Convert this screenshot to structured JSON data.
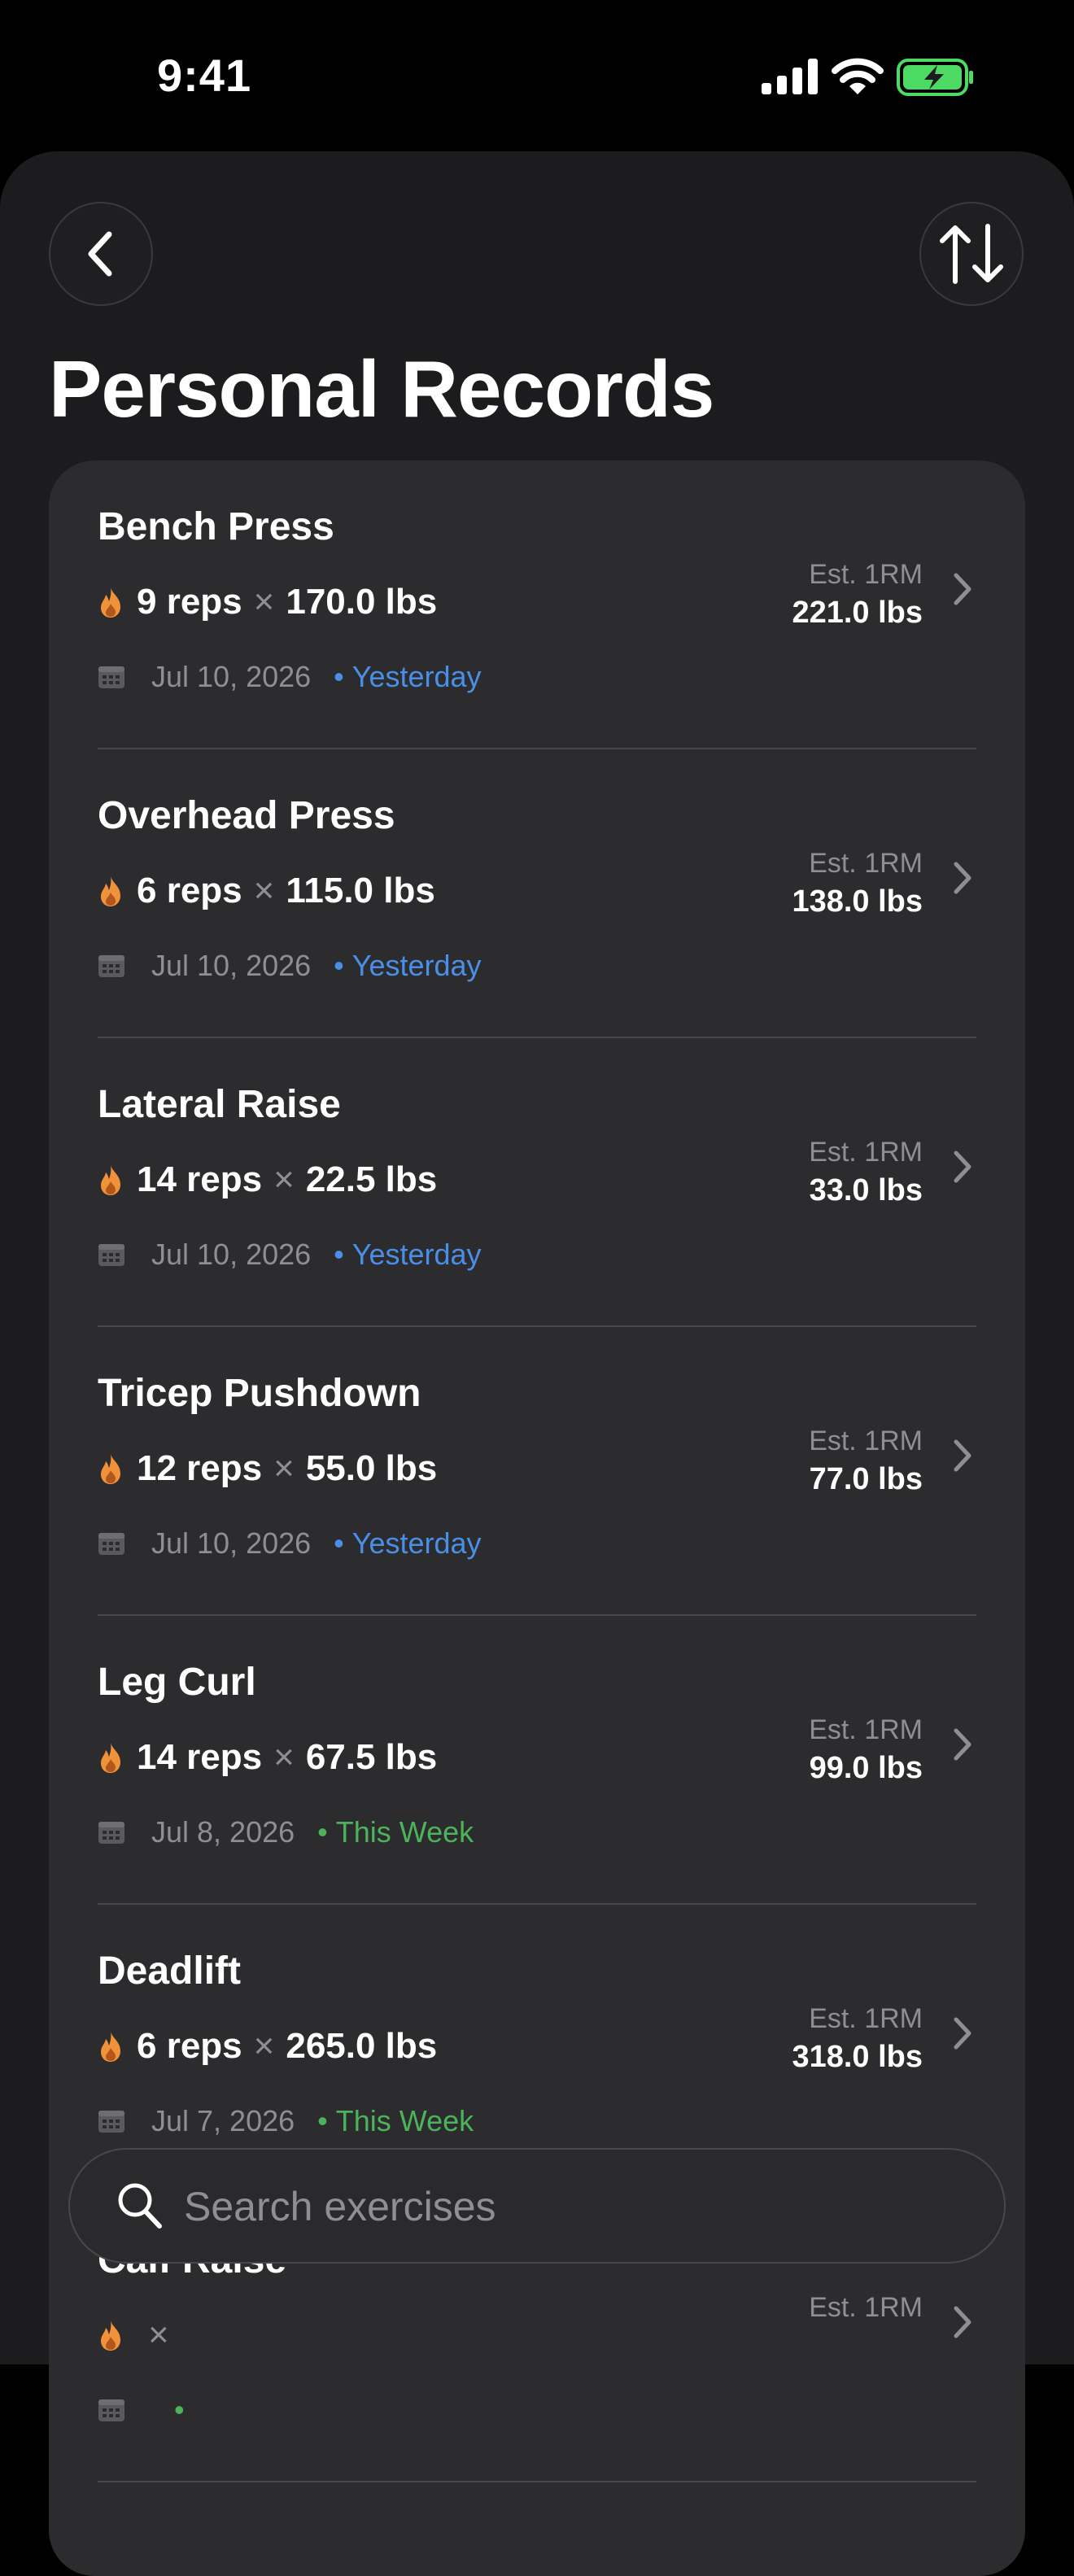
{
  "status_bar": {
    "time": "9:41"
  },
  "header": {
    "title": "Personal Records"
  },
  "records": [
    {
      "exercise": "Bench Press",
      "reps": "9 reps",
      "weight": "170.0 lbs",
      "est_label": "Est. 1RM",
      "est_value": "221.0 lbs",
      "date": "Jul 10, 2026",
      "relative": "Yesterday",
      "relative_color": "#4a8fe7"
    },
    {
      "exercise": "Overhead Press",
      "reps": "6 reps",
      "weight": "115.0 lbs",
      "est_label": "Est. 1RM",
      "est_value": "138.0 lbs",
      "date": "Jul 10, 2026",
      "relative": "Yesterday",
      "relative_color": "#4a8fe7"
    },
    {
      "exercise": "Lateral Raise",
      "reps": "14 reps",
      "weight": "22.5 lbs",
      "est_label": "Est. 1RM",
      "est_value": "33.0 lbs",
      "date": "Jul 10, 2026",
      "relative": "Yesterday",
      "relative_color": "#4a8fe7"
    },
    {
      "exercise": "Tricep Pushdown",
      "reps": "12 reps",
      "weight": "55.0 lbs",
      "est_label": "Est. 1RM",
      "est_value": "77.0 lbs",
      "date": "Jul 10, 2026",
      "relative": "Yesterday",
      "relative_color": "#4a8fe7"
    },
    {
      "exercise": "Leg Curl",
      "reps": "14 reps",
      "weight": "67.5 lbs",
      "est_label": "Est. 1RM",
      "est_value": "99.0 lbs",
      "date": "Jul 8, 2026",
      "relative": "This Week",
      "relative_color": "#4cb35a"
    },
    {
      "exercise": "Deadlift",
      "reps": "6 reps",
      "weight": "265.0 lbs",
      "est_label": "Est. 1RM",
      "est_value": "318.0 lbs",
      "date": "Jul 7, 2026",
      "relative": "This Week",
      "relative_color": "#4cb35a"
    },
    {
      "exercise": "Calf Raise",
      "reps": "",
      "weight": "",
      "est_label": "Est. 1RM",
      "est_value": "",
      "date": "",
      "relative": "",
      "relative_color": "#4cb35a"
    }
  ],
  "labels": {
    "times_symbol": "×",
    "dot": "•"
  },
  "search": {
    "placeholder": "Search exercises"
  },
  "colors": {
    "flame": "#f0923a",
    "background": "#1c1c1e",
    "card": "#2c2c2e",
    "battery": "#4cd964"
  },
  "icons": {
    "back": "chevron-left-icon",
    "sort": "sort-arrows-icon",
    "search": "search-icon",
    "flame": "flame-icon",
    "calendar": "calendar-icon",
    "chevron": "chevron-right-icon"
  }
}
